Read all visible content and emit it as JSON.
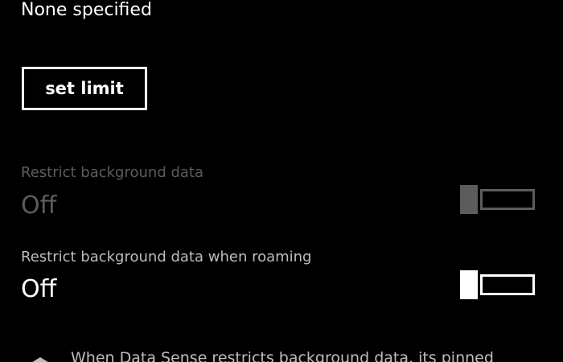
{
  "limit": {
    "value": "None specified",
    "set_limit_label": "set limit"
  },
  "settings": [
    {
      "label": "Restrict background data",
      "value": "Off",
      "enabled": false
    },
    {
      "label": "Restrict background data when roaming",
      "value": "Off",
      "enabled": true
    }
  ],
  "info": {
    "icon": "pin-icon",
    "text": "When Data Sense restricts background data, its pinned"
  },
  "colors": {
    "background": "#000000",
    "text": "#ffffff",
    "disabled": "#5c5c5c",
    "label": "#bdbdbd"
  }
}
